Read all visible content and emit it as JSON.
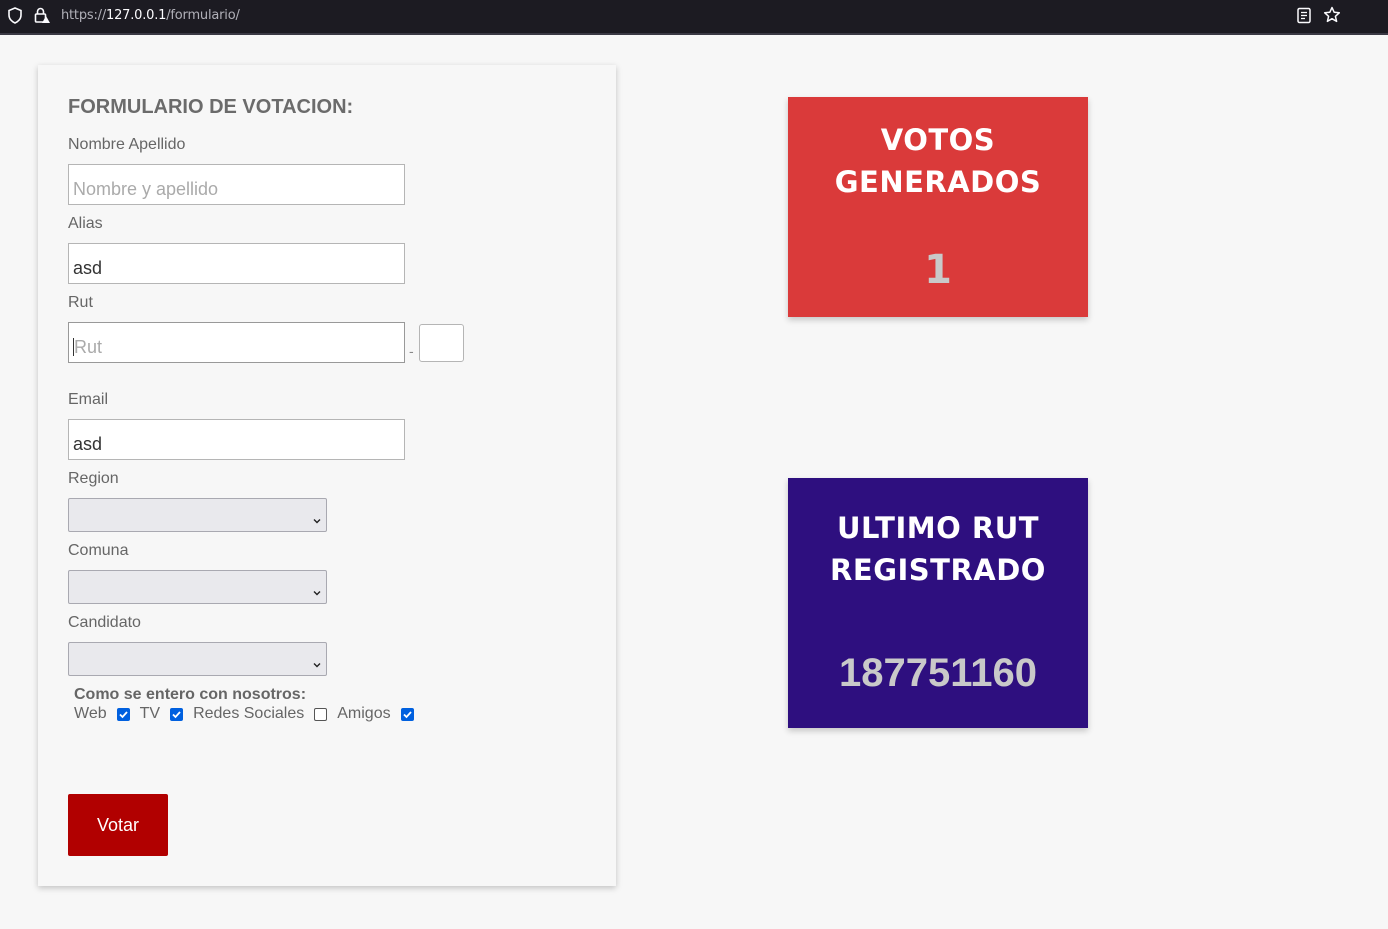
{
  "browser": {
    "url_scheme": "https://",
    "url_host": "127.0.0.1",
    "url_path": "/formulario/"
  },
  "form": {
    "title": "FORMULARIO DE VOTACION:",
    "fields": {
      "nombre": {
        "label": "Nombre Apellido",
        "value": "",
        "placeholder": "Nombre y apellido"
      },
      "alias": {
        "label": "Alias",
        "value": "asd",
        "placeholder": ""
      },
      "rut": {
        "label": "Rut",
        "value": "",
        "placeholder": "Rut",
        "separator": "-",
        "dv_value": ""
      },
      "email": {
        "label": "Email",
        "value": "asd",
        "placeholder": ""
      },
      "region": {
        "label": "Region",
        "selected": ""
      },
      "comuna": {
        "label": "Comuna",
        "selected": ""
      },
      "candidato": {
        "label": "Candidato",
        "selected": ""
      }
    },
    "source": {
      "label": "Como se entero con nosotros:",
      "options": [
        {
          "label": "Web",
          "checked": true
        },
        {
          "label": "TV",
          "checked": true
        },
        {
          "label": "Redes Sociales",
          "checked": false
        },
        {
          "label": "Amigos",
          "checked": true
        }
      ]
    },
    "submit_label": "Votar"
  },
  "stats": {
    "votes": {
      "title_line1": "VOTOS",
      "title_line2": "GENERADOS",
      "value": "1",
      "color": "#da3a3a"
    },
    "last_rut": {
      "title_line1": "ULTIMO RUT",
      "title_line2": "REGISTRADO",
      "value": "187751160",
      "color": "#2e0f7f"
    }
  },
  "colors": {
    "button": "#b10000",
    "checkbox_accent": "#0060df"
  }
}
